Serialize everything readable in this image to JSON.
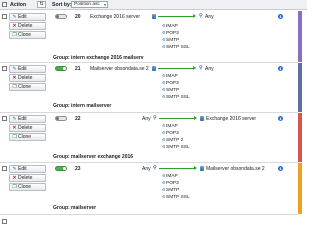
{
  "toolbar": {
    "action_label": "Action",
    "sort_icon": "sort-order-icon",
    "sort_label": "Sort by:",
    "sort_value": "Position asc"
  },
  "buttons": {
    "edit": "Edit",
    "delete": "Delete",
    "clone": "Clone"
  },
  "rules": [
    {
      "priority": "20",
      "enabled": false,
      "source": "Exchange 2016 server",
      "source_icon": "server-icon",
      "services": [
        "IMAP",
        "POP3",
        "SMTP",
        "SMTP SSL"
      ],
      "destination": "Any",
      "destination_icon": "any-icon",
      "group": "Group: intern exchange 2016 mailserv",
      "accent": "#8a6fc1"
    },
    {
      "priority": "21",
      "enabled": true,
      "source": "Mailserver obsondata.se 2",
      "source_icon": "server-icon",
      "services": [
        "IMAP",
        "POP3",
        "SMTP",
        "SMTP SSL"
      ],
      "destination": "Any",
      "destination_icon": "any-icon",
      "group": "Group: intern mailserver",
      "accent": "#5e6fa8"
    },
    {
      "priority": "22",
      "enabled": false,
      "source": "Any",
      "source_icon": "any-icon",
      "services": [
        "IMAP",
        "POP3",
        "SMTP 2",
        "SMTP SSL"
      ],
      "destination": "Exchange 2016 server",
      "destination_icon": "server-icon",
      "group": "Group: mailserver exchange 2016",
      "accent": "#d9534f"
    },
    {
      "priority": "23",
      "enabled": true,
      "source": "Any",
      "source_icon": "any-icon",
      "services": [
        "IMAP",
        "POP3",
        "SMTP",
        "SMTP SSL"
      ],
      "destination": "Mailserver obsondata.se 2",
      "destination_icon": "server-icon",
      "group": "Group: mailserver",
      "accent": "#f0a020"
    }
  ],
  "colors": {
    "arrow": "#2ea02e",
    "toggle_on": "#4caf50",
    "info": "#2a6fd6"
  }
}
